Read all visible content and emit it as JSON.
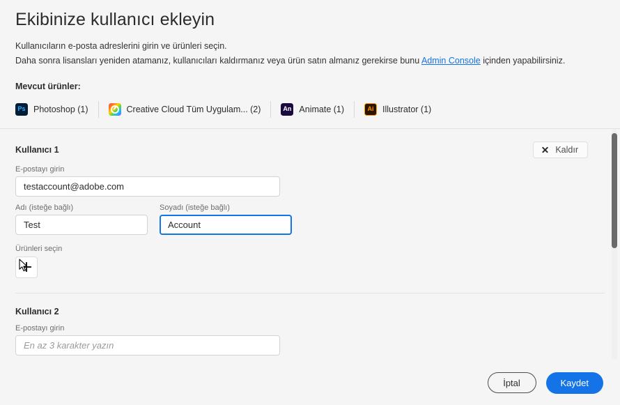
{
  "dialog": {
    "title": "Ekibinize kullanıcı ekleyin",
    "intro_line_1": "Kullanıcıların e-posta adreslerini girin ve ürünleri seçin.",
    "intro_line_2_before": "Daha sonra lisansları yeniden atamanız, kullanıcıları kaldırmanız veya ürün satın almanız gerekirse bunu ",
    "intro_link": "Admin Console",
    "intro_line_2_after": " içinden yapabilirsiniz."
  },
  "products": {
    "label": "Mevcut ürünler:",
    "items": [
      {
        "icon": "photoshop-icon",
        "glyph": "Ps",
        "name": "Photoshop (1)"
      },
      {
        "icon": "creative-cloud-icon",
        "glyph": "",
        "name": "Creative Cloud Tüm Uygulam... (2)"
      },
      {
        "icon": "animate-icon",
        "glyph": "An",
        "name": "Animate (1)"
      },
      {
        "icon": "illustrator-icon",
        "glyph": "Ai",
        "name": "Illustrator (1)"
      }
    ]
  },
  "users": [
    {
      "title": "Kullanıcı 1",
      "remove_label": "Kaldır",
      "email_label": "E-postayı girin",
      "email_value": "testaccount@adobe.com",
      "email_placeholder": "",
      "first_name_label": "Adı (isteğe bağlı)",
      "first_name_value": "Test",
      "last_name_label": "Soyadı (isteğe bağlı)",
      "last_name_value": "Account",
      "products_label": "Ürünleri seçin",
      "add_product_label": "+"
    },
    {
      "title": "Kullanıcı 2",
      "email_label": "E-postayı girin",
      "email_value": "",
      "email_placeholder": "En az 3 karakter yazın"
    }
  ],
  "footer": {
    "cancel_label": "İptal",
    "save_label": "Kaydet"
  },
  "colors": {
    "accent_blue": "#1473e6",
    "background": "#f5f5f5",
    "text": "#2c2c2c"
  }
}
